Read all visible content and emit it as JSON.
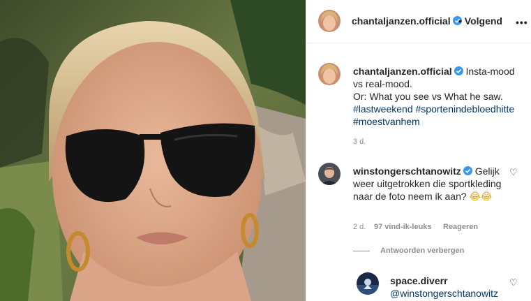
{
  "post": {
    "username": "chantaljanzen.official",
    "follow_separator": "•",
    "follow_label": "Volgend",
    "more_label": "•••"
  },
  "caption": {
    "username": "chantaljanzen.official",
    "text_line1": "Insta-mood",
    "text_line2": "vs real-mood.",
    "text_line3": "Or: What you see vs What he saw.",
    "hashtag1": "#lastweekend",
    "hashtag2": "#sportenindebloedhitte",
    "hashtag3": "#moestvanhem",
    "time": "3 d."
  },
  "comment": {
    "username": "winstongerschtanowitz",
    "text": "Gelijk weer uitgetrokken die sportkleding naar de foto neem ik aan?",
    "emoji": "😂😂",
    "time": "2 d.",
    "likes": "97 vind-ik-leuks",
    "reply_label": "Reageren",
    "hide_replies": "Antwoorden verbergen"
  },
  "reply": {
    "username": "space.diverr",
    "mention": "@winstongerschtanowitz"
  },
  "icons": {
    "verified": "verified-badge-icon",
    "heart": "heart-outline-icon",
    "accent": "#3897f0",
    "hashtag_color": "#00376b"
  }
}
